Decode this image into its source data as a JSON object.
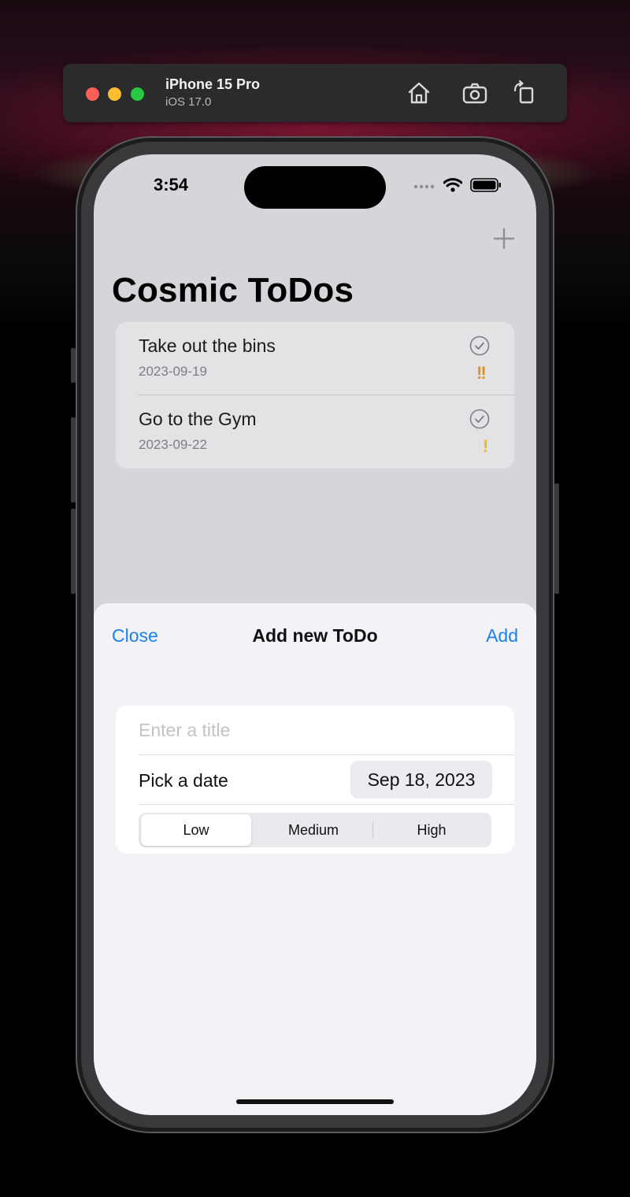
{
  "simulator": {
    "device_name": "iPhone 15 Pro",
    "os_version": "iOS 17.0",
    "toolbar_icons": [
      "home-icon",
      "screenshot-icon",
      "rotate-icon"
    ]
  },
  "status_bar": {
    "time": "3:54",
    "icons": [
      "cellular-icon",
      "wifi-icon",
      "battery-icon"
    ]
  },
  "app": {
    "title": "Cosmic ToDos",
    "add_icon": "plus-icon",
    "todos": [
      {
        "title": "Take out the bins",
        "date": "2023-09-19",
        "priority_mark": "!!",
        "priority_color": "#e0921d"
      },
      {
        "title": "Go to the Gym",
        "date": "2023-09-22",
        "priority_mark": "!",
        "priority_color": "#e6bb1a"
      }
    ]
  },
  "sheet": {
    "close_label": "Close",
    "title": "Add new ToDo",
    "add_label": "Add",
    "title_placeholder": "Enter a title",
    "title_value": "",
    "date_label": "Pick a date",
    "date_value": "Sep 18, 2023",
    "priority_options": [
      "Low",
      "Medium",
      "High"
    ],
    "priority_selected": "Low"
  },
  "colors": {
    "accent": "#1a82ea",
    "traffic_red": "#ff5f57",
    "traffic_yellow": "#febc2e",
    "traffic_green": "#28c840"
  }
}
